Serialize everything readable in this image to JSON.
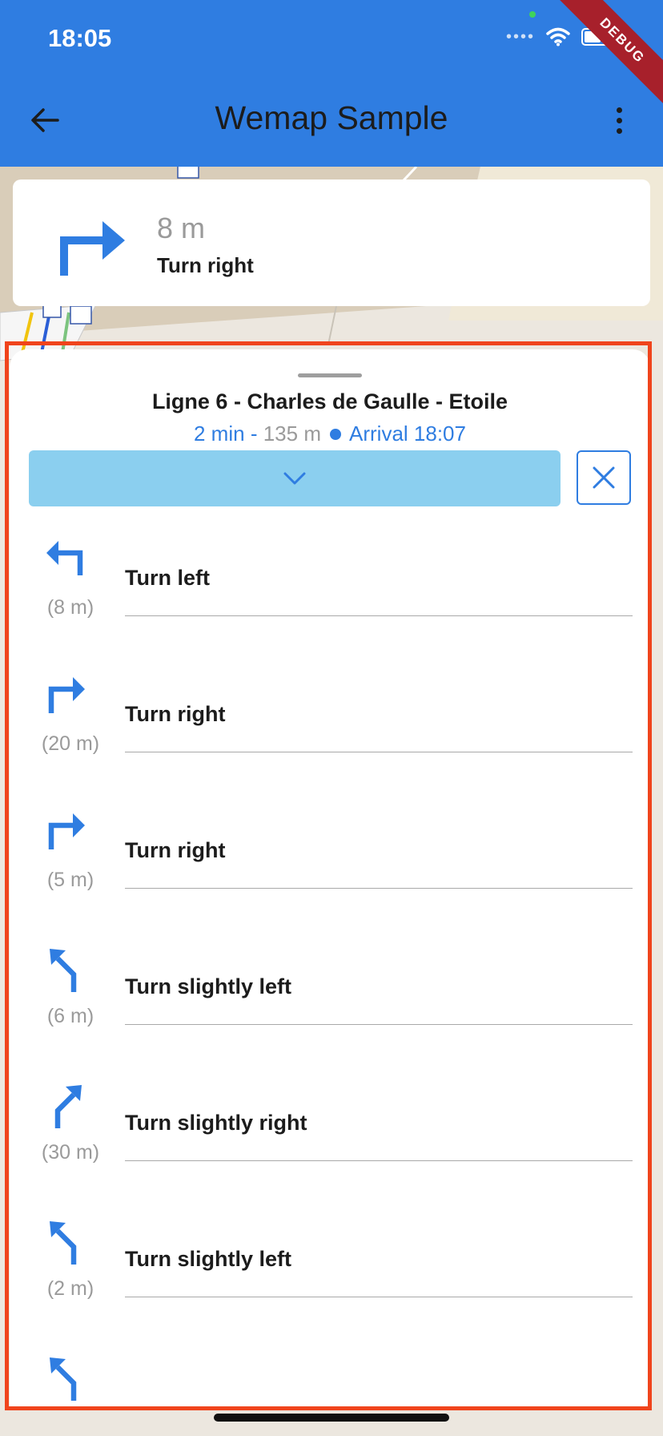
{
  "status_bar": {
    "time": "18:05",
    "icons": [
      "signal-dots-icon",
      "wifi-icon",
      "battery-icon"
    ]
  },
  "debug_banner": "DEBUG",
  "app_bar": {
    "title": "Wemap Sample",
    "back_icon": "arrow-left-icon",
    "menu_icon": "more-vertical-icon"
  },
  "next_instruction": {
    "distance": "8 m",
    "text": "Turn right",
    "icon": "turn-right-icon"
  },
  "route": {
    "title": "Ligne 6 - Charles de Gaulle - Etoile",
    "duration": "2 min",
    "separator": "-",
    "length": "135 m",
    "arrival": "Arrival 18:07"
  },
  "controls": {
    "expand_icon": "chevron-down-icon",
    "close_icon": "close-icon"
  },
  "steps": [
    {
      "icon": "turn-left-icon",
      "text": "Turn left",
      "distance": "(8 m)"
    },
    {
      "icon": "turn-right-icon",
      "text": "Turn right",
      "distance": "(20 m)"
    },
    {
      "icon": "turn-right-icon",
      "text": "Turn right",
      "distance": "(5 m)"
    },
    {
      "icon": "turn-slight-left-icon",
      "text": "Turn slightly left",
      "distance": "(6 m)"
    },
    {
      "icon": "turn-slight-right-icon",
      "text": "Turn slightly right",
      "distance": "(30 m)"
    },
    {
      "icon": "turn-slight-left-icon",
      "text": "Turn slightly left",
      "distance": "(2 m)"
    }
  ],
  "colors": {
    "primary": "#2f7de1",
    "app_bar": "#2f7de1",
    "expand_button": "#8bcfef",
    "highlight_frame": "#f0441c",
    "debug_banner": "#a7202b",
    "secondary_text": "#9a9a9a"
  }
}
